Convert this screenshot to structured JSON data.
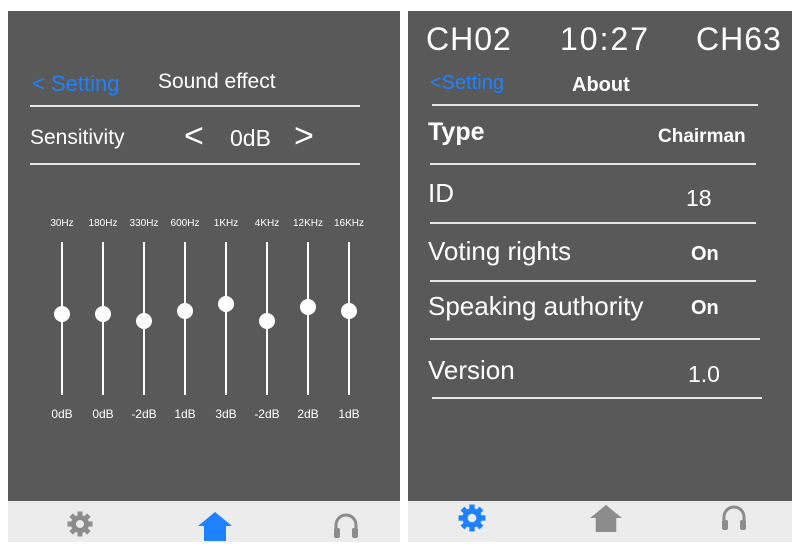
{
  "colors": {
    "panel": "#5a595a",
    "accent": "#1e82ff",
    "bar": "#ececec",
    "icon_gray": "#8c8c8c"
  },
  "left": {
    "back_label": "< Setting",
    "title": "Sound effect",
    "sensitivity": {
      "label": "Sensitivity",
      "prev": "<",
      "value": "0dB",
      "next": ">"
    },
    "eq_bands": [
      {
        "freq": "30Hz",
        "db_label": "0dB",
        "db": 0
      },
      {
        "freq": "180Hz",
        "db_label": "0dB",
        "db": 0
      },
      {
        "freq": "330Hz",
        "db_label": "-2dB",
        "db": -2
      },
      {
        "freq": "600Hz",
        "db_label": "1dB",
        "db": 1
      },
      {
        "freq": "1KHz",
        "db_label": "3dB",
        "db": 3
      },
      {
        "freq": "4KHz",
        "db_label": "-2dB",
        "db": -2
      },
      {
        "freq": "12KHz",
        "db_label": "2dB",
        "db": 2
      },
      {
        "freq": "16KHz",
        "db_label": "1dB",
        "db": 1
      }
    ],
    "nav": [
      {
        "icon": "gear-icon",
        "active": false
      },
      {
        "icon": "home-icon",
        "active": true
      },
      {
        "icon": "headphones-icon",
        "active": false
      }
    ]
  },
  "right": {
    "status": {
      "left": "CH02",
      "time": "10:27",
      "right": "CH63"
    },
    "back_label": "<Setting",
    "title": "About",
    "rows": [
      {
        "label": "Type",
        "value": "Chairman"
      },
      {
        "label": "ID",
        "value": "18"
      },
      {
        "label": "Voting rights",
        "value": "On"
      },
      {
        "label": "Speaking authority",
        "value": "On"
      },
      {
        "label": "Version",
        "value": "1.0"
      }
    ],
    "nav": [
      {
        "icon": "gear-icon",
        "active": true
      },
      {
        "icon": "home-icon",
        "active": false
      },
      {
        "icon": "headphones-icon",
        "active": false
      }
    ]
  }
}
